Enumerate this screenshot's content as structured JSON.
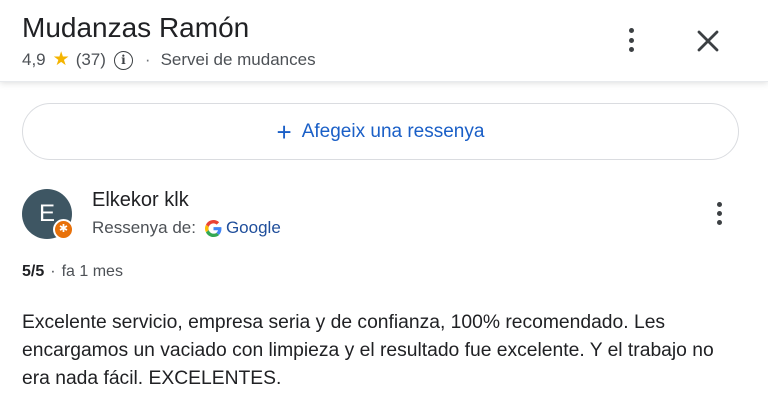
{
  "header": {
    "title": "Mudanzas Ramón",
    "rating": "4,9",
    "review_count": "(37)",
    "category": "Servei de mudances",
    "separator": "·",
    "icons": [
      "star-icon",
      "info-icon",
      "more-vert-icon",
      "close-icon"
    ]
  },
  "add_review": {
    "label": "Afegeix una ressenya",
    "plus": "+"
  },
  "review": {
    "avatar_letter": "E",
    "author": "Elkekor klk",
    "source_prefix": "Ressenya de:",
    "source_name": "Google",
    "score": "5/5",
    "separator": "·",
    "age": "fa 1 mes",
    "text": "Excelente servicio, empresa seria y de confianza, 100% recomendado. Les encargamos un vaciado con limpieza y el resultado fue excelente. Y el trabajo no era nada fácil. EXCELENTES."
  },
  "colors": {
    "accent": "#1a5fc7",
    "star": "#f4b400",
    "avatar_bg": "#3e5663",
    "badge": "#e8710a"
  }
}
